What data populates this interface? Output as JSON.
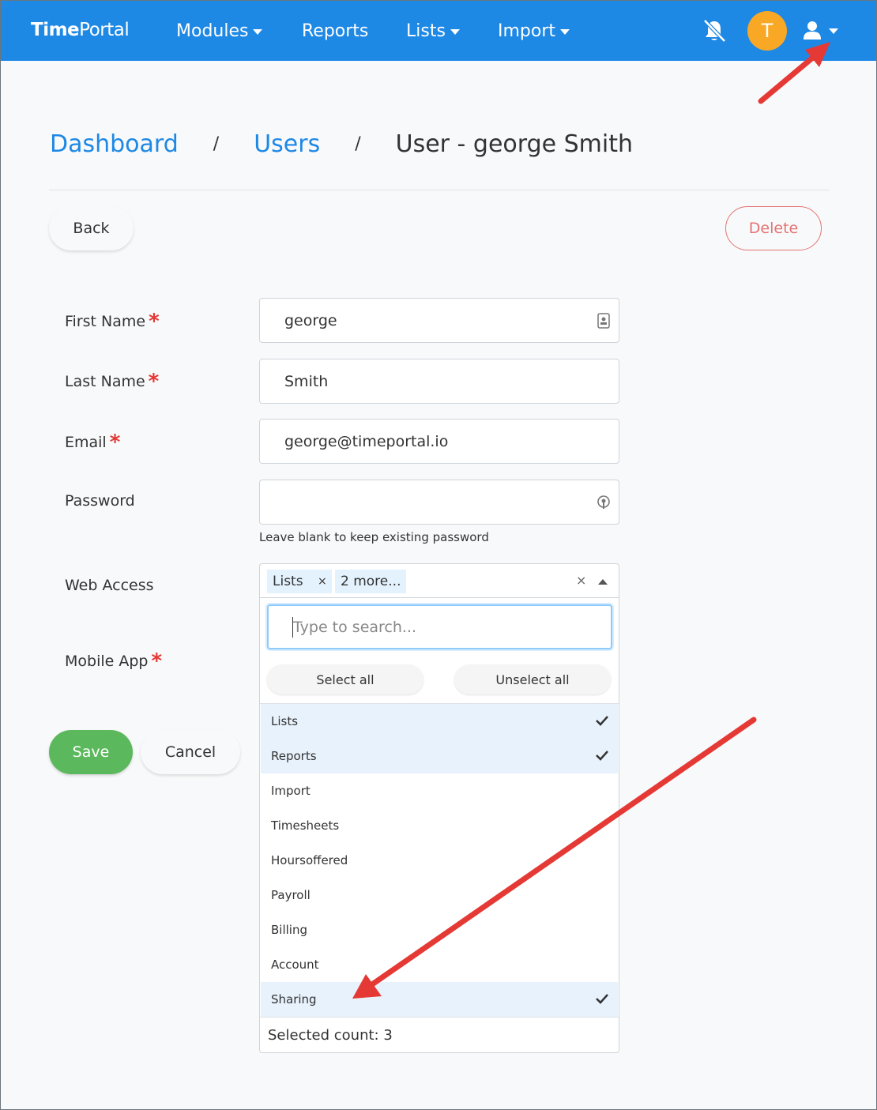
{
  "navbar": {
    "brand_part1": "Time",
    "brand_part2": "Portal",
    "menu": [
      "Modules",
      "Reports",
      "Lists",
      "Import"
    ],
    "avatar_initial": "T",
    "bell_icon": "bell-slash-icon",
    "user_icon": "user-icon",
    "accent_color": "#1e88e5"
  },
  "breadcrumb": {
    "items": [
      "Dashboard",
      "Users"
    ],
    "separator": "/",
    "current": "User - george Smith"
  },
  "actions": {
    "back": "Back",
    "delete": "Delete"
  },
  "form": {
    "first_name_label": "First Name",
    "first_name_value": "george",
    "last_name_label": "Last Name",
    "last_name_value": "Smith",
    "email_label": "Email",
    "email_value": "george@timeportal.io",
    "password_label": "Password",
    "password_value": "",
    "password_help": "Leave blank to keep existing password",
    "web_access_label": "Web Access",
    "mobile_app_label": "Mobile App",
    "required_marker": "*"
  },
  "web_access": {
    "tags": [
      "Lists",
      "2 more..."
    ],
    "tag_remove": "×",
    "clear": "×",
    "search_placeholder": "Type to search...",
    "select_all": "Select all",
    "unselect_all": "Unselect all",
    "options": [
      {
        "label": "Lists",
        "selected": true
      },
      {
        "label": "Reports",
        "selected": true
      },
      {
        "label": "Import",
        "selected": false
      },
      {
        "label": "Timesheets",
        "selected": false
      },
      {
        "label": "Hoursoffered",
        "selected": false
      },
      {
        "label": "Payroll",
        "selected": false
      },
      {
        "label": "Billing",
        "selected": false
      },
      {
        "label": "Account",
        "selected": false
      },
      {
        "label": "Sharing",
        "selected": true
      }
    ],
    "selected_count": "Selected count: 3"
  },
  "footer_actions": {
    "save": "Save",
    "cancel": "Cancel"
  }
}
